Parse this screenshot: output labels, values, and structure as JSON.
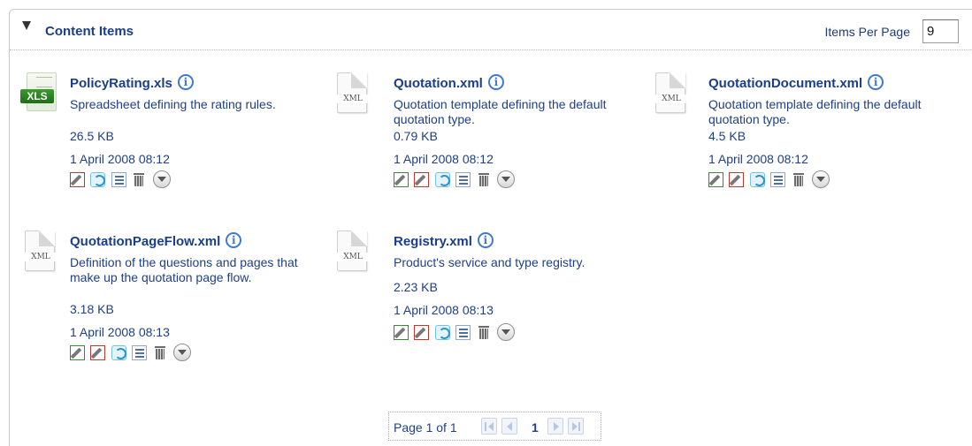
{
  "panel": {
    "title": "Content Items",
    "items_per_page_label": "Items Per Page",
    "items_per_page_value": "9"
  },
  "items": [
    {
      "name": "PolicyRating.xls",
      "icon": "xls-file-icon",
      "icon_label": "XLS",
      "description": "Spreadsheet defining the rating rules.",
      "size": "26.5 KB",
      "date": "1 April 2008 08:12",
      "actions": [
        "edit-red",
        "refresh",
        "list",
        "trash",
        "more"
      ]
    },
    {
      "name": "Quotation.xml",
      "icon": "xml-file-icon",
      "icon_label": "XML",
      "description": "Quotation template defining the default quotation type.",
      "size": "0.79 KB",
      "date": "1 April 2008 08:12",
      "actions": [
        "edit-green",
        "edit-red",
        "refresh",
        "list",
        "trash",
        "more"
      ]
    },
    {
      "name": "QuotationDocument.xml",
      "icon": "xml-file-icon",
      "icon_label": "XML",
      "description": "Quotation template defining the default quotation type.",
      "size": "4.5 KB",
      "date": "1 April 2008 08:12",
      "actions": [
        "edit-green",
        "edit-red",
        "refresh",
        "list",
        "trash",
        "more"
      ]
    },
    {
      "name": "QuotationPageFlow.xml",
      "icon": "xml-file-icon",
      "icon_label": "XML",
      "description": "Definition of the questions and pages that make up the quotation page flow.",
      "size": "3.18 KB",
      "date": "1 April 2008 08:13",
      "actions": [
        "edit-green",
        "edit-red",
        "refresh",
        "list",
        "trash",
        "more"
      ]
    },
    {
      "name": "Registry.xml",
      "icon": "xml-file-icon",
      "icon_label": "XML",
      "description": "Product's service and type registry.",
      "size": "2.23 KB",
      "date": "1 April 2008 08:13",
      "actions": [
        "edit-green",
        "edit-red",
        "refresh",
        "list",
        "trash",
        "more"
      ]
    }
  ],
  "pager": {
    "text": "Page 1 of 1",
    "current_page": "1"
  },
  "colors": {
    "link": "#1a3e8c",
    "info_icon": "#3f78d6",
    "xls_green": "#2b8222"
  }
}
